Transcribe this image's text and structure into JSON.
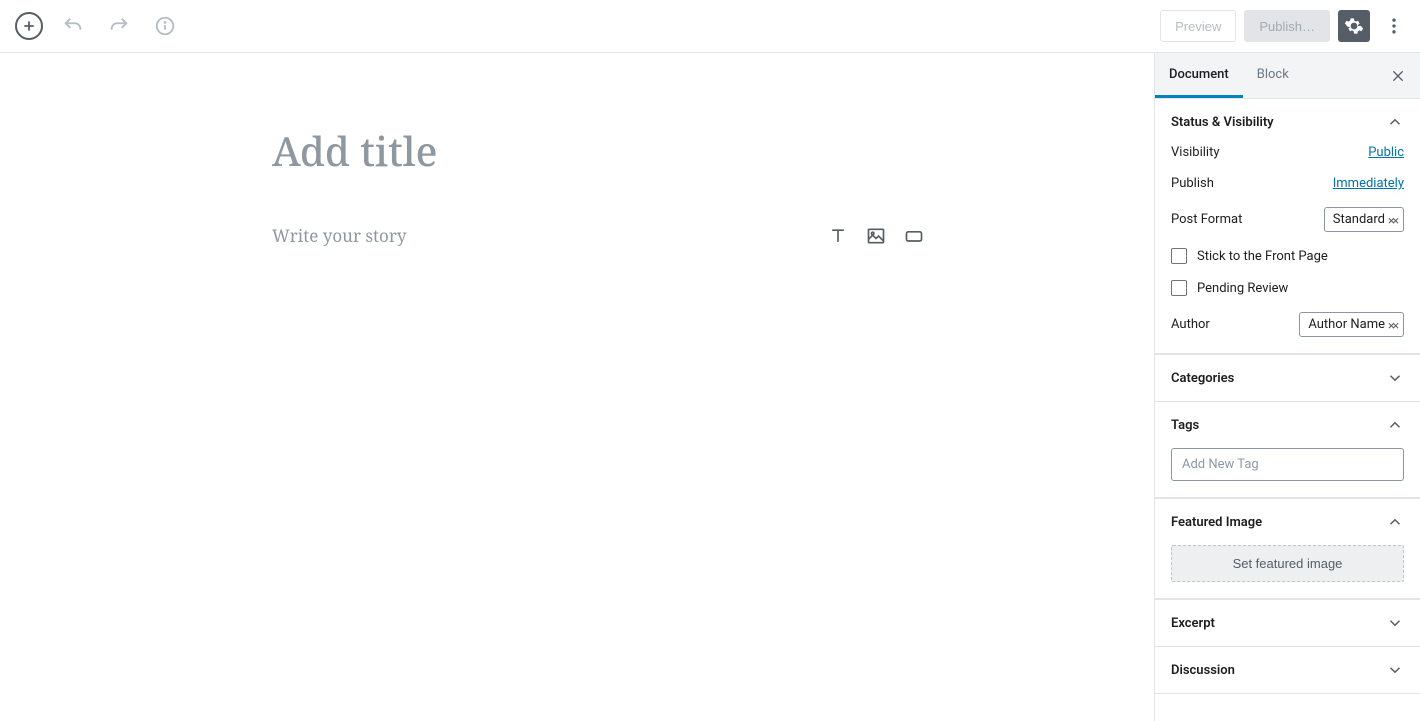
{
  "toolbar": {
    "preview": "Preview",
    "publish": "Publish…"
  },
  "editor": {
    "title_placeholder": "Add title",
    "content_placeholder": "Write your story"
  },
  "sidebar": {
    "tab_document": "Document",
    "tab_block": "Block",
    "panels": {
      "status": {
        "title": "Status & Visibility",
        "visibility_label": "Visibility",
        "visibility_value": "Public",
        "publish_label": "Publish",
        "publish_value": "Immediately",
        "post_format_label": "Post Format",
        "post_format_value": "Standard",
        "stick_label": "Stick to the Front Page",
        "pending_label": "Pending Review",
        "author_label": "Author",
        "author_value": "Author Name"
      },
      "categories": {
        "title": "Categories"
      },
      "tags": {
        "title": "Tags",
        "placeholder": "Add New Tag"
      },
      "featured": {
        "title": "Featured Image",
        "button": "Set featured image"
      },
      "excerpt": {
        "title": "Excerpt"
      },
      "discussion": {
        "title": "Discussion"
      }
    }
  }
}
